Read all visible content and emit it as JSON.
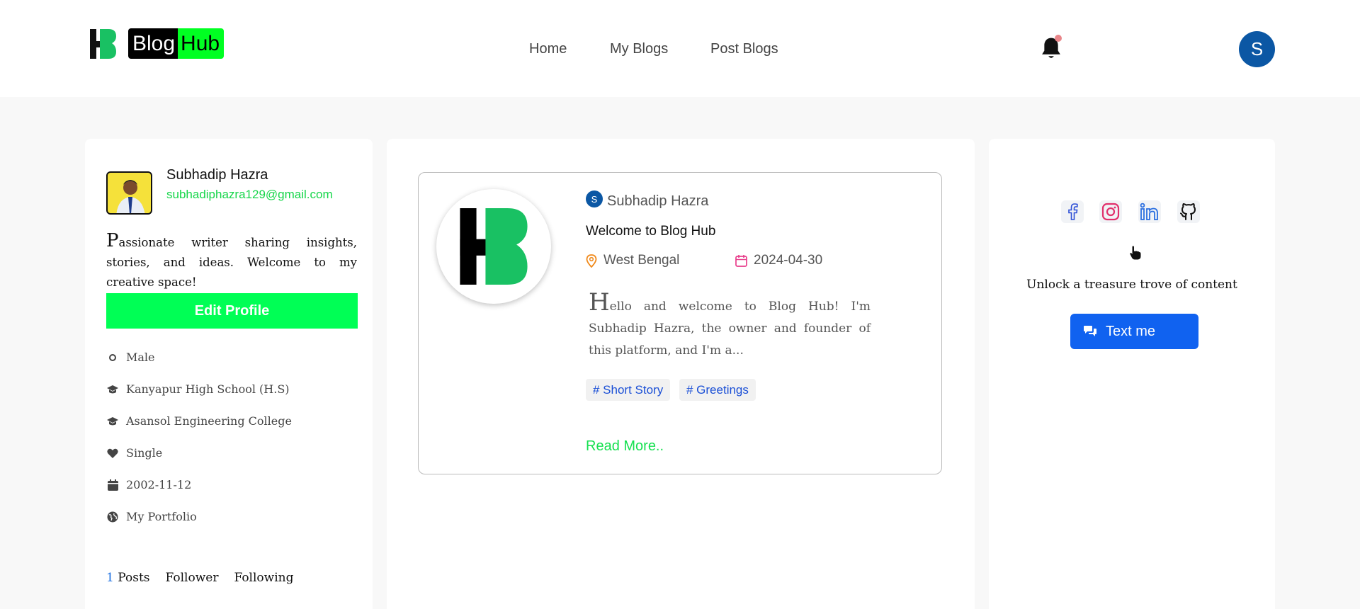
{
  "header": {
    "logo_blog": "Blog",
    "logo_hub": "Hub",
    "avatar_letter": "S",
    "nav": [
      {
        "label": "Home"
      },
      {
        "label": "My Blogs"
      },
      {
        "label": "Post Blogs"
      }
    ]
  },
  "profile": {
    "name": "Subhadip Hazra",
    "email": "subhadiphazra129@gmail.com",
    "bio": "Passionate writer sharing insights, stories, and ideas. Welcome to my creative space!",
    "edit_label": "Edit Profile",
    "info": [
      {
        "icon": "circle-icon",
        "text": "Male"
      },
      {
        "icon": "graduation-cap-icon",
        "text": "Kanyapur High School (H.S)"
      },
      {
        "icon": "graduation-cap-icon",
        "text": "Asansol Engineering College"
      },
      {
        "icon": "heart-icon",
        "text": "Single"
      },
      {
        "icon": "calendar-icon",
        "text": "2002-11-12"
      },
      {
        "icon": "globe-icon",
        "text": "My Portfolio"
      }
    ],
    "stats": {
      "posts_count": "1",
      "posts_label": "Posts",
      "follower_label": "Follower",
      "following_label": "Following"
    }
  },
  "post": {
    "author_initial": "S",
    "author": "Subhadip Hazra",
    "title": "Welcome to Blog Hub",
    "location": "West Bengal",
    "date": "2024-04-30",
    "excerpt": "Hello and welcome to Blog Hub! I'm Subhadip Hazra, the owner and founder of this platform, and I'm a...",
    "tags": [
      "# Short Story",
      "# Greetings"
    ],
    "read_more": "Read More.."
  },
  "sidebar_right": {
    "socials": [
      "facebook-icon",
      "instagram-icon",
      "linkedin-icon",
      "github-icon"
    ],
    "unlock_text": "Unlock a treasure trove of content",
    "text_me_label": "Text me"
  },
  "colors": {
    "brand_green": "#00ff22",
    "accent_blue": "#1062f0",
    "avatar_blue": "#0b57a4"
  }
}
